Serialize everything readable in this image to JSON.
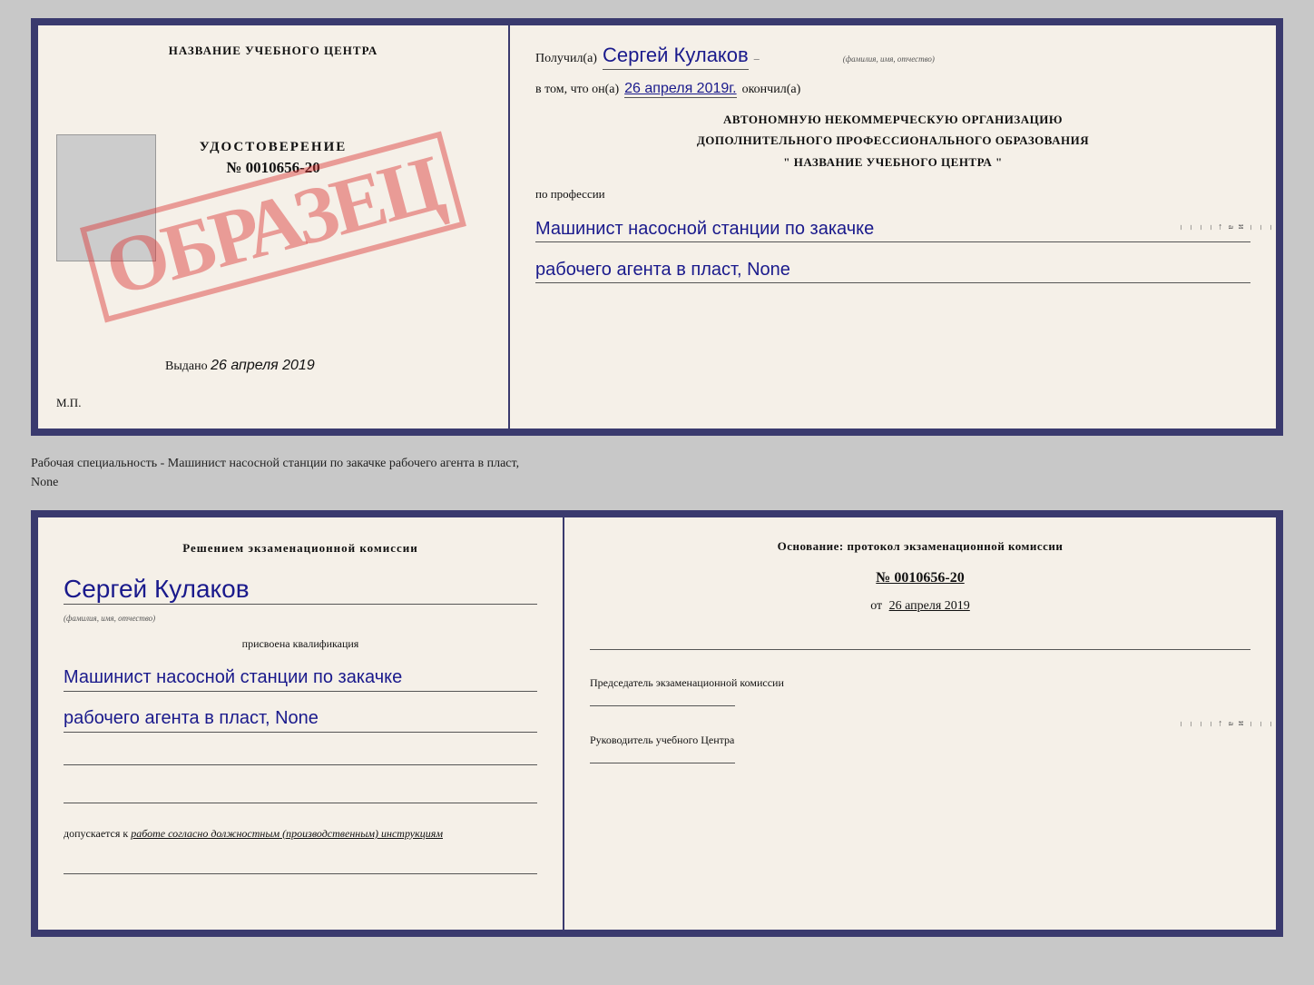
{
  "top_left": {
    "school_name": "НАЗВАНИЕ УЧЕБНОГО ЦЕНТРА",
    "stamp_text": "ОБРАЗЕЦ",
    "cert_label": "УДОСТОВЕРЕНИЕ",
    "cert_number": "№ 0010656-20",
    "issued_label": "Выдано",
    "issued_date": "26 апреля 2019",
    "mp_label": "М.П."
  },
  "top_right": {
    "recipient_label": "Получил(а)",
    "recipient_name": "Сергей Кулаков",
    "recipient_hint": "(фамилия, имя, отчество)",
    "date_prefix": "в том, что он(а)",
    "date_value": "26 апреля 2019г.",
    "date_suffix": "окончил(а)",
    "org_line1": "АВТОНОМНУЮ НЕКОММЕРЧЕСКУЮ ОРГАНИЗАЦИЮ",
    "org_line2": "ДОПОЛНИТЕЛЬНОГО ПРОФЕССИОНАЛЬНОГО ОБРАЗОВАНИЯ",
    "org_line3": "\" НАЗВАНИЕ УЧЕБНОГО ЦЕНТРА \"",
    "profession_label": "по профессии",
    "profession_line1": "Машинист насосной станции по закачке",
    "profession_line2": "рабочего агента в пласт, None"
  },
  "separator": {
    "text": "Рабочая специальность - Машинист насосной станции по закачке рабочего агента в пласт,",
    "text2": "None"
  },
  "bottom_left": {
    "commission_text": "Решением экзаменационной комиссии",
    "name": "Сергей Кулаков",
    "name_hint": "(фамилия, имя, отчество)",
    "qualification_label": "присвоена квалификация",
    "qualification_line1": "Машинист насосной станции по закачке",
    "qualification_line2": "рабочего агента в пласт, None",
    "admission_text": "допускается к",
    "admission_detail": "работе согласно должностным (производственным) инструкциям"
  },
  "bottom_right": {
    "basis_label": "Основание: протокол экзаменационной комиссии",
    "protocol_number": "№ 0010656-20",
    "protocol_date_prefix": "от",
    "protocol_date": "26 апреля 2019",
    "chairman_label": "Председатель экзаменационной комиссии",
    "director_label": "Руководитель учебного Центра"
  },
  "right_deco": {
    "chars": [
      "–",
      "–",
      "–",
      "и",
      "а",
      "←",
      "–",
      "–",
      "–",
      "–",
      "–"
    ]
  }
}
